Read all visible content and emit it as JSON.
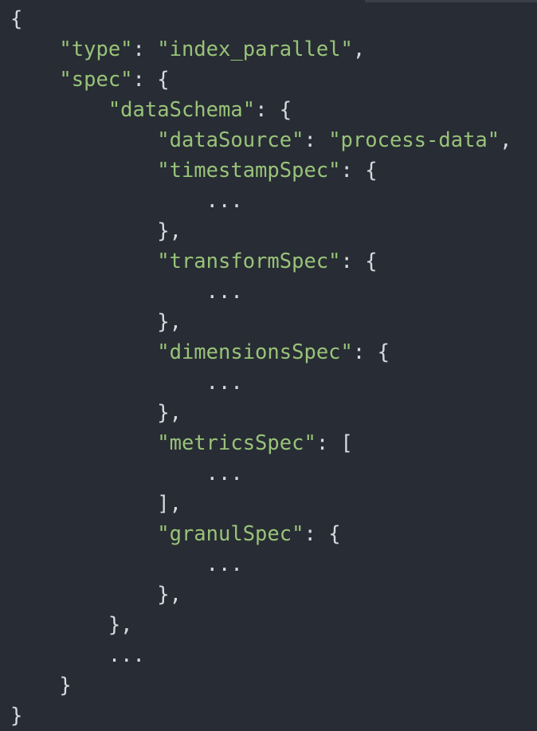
{
  "editor": {
    "lines": [
      {
        "indent": 0,
        "key": "",
        "sep": "",
        "value": "",
        "punct": "{"
      },
      {
        "indent": 1,
        "key": "\"type\"",
        "sep": ": ",
        "value": "\"index_parallel\"",
        "punct": ","
      },
      {
        "indent": 1,
        "key": "\"spec\"",
        "sep": ": ",
        "value": "",
        "punct": "{"
      },
      {
        "indent": 2,
        "key": "\"dataSchema\"",
        "sep": ": ",
        "value": "",
        "punct": "{"
      },
      {
        "indent": 3,
        "key": "\"dataSource\"",
        "sep": ": ",
        "value": "\"process-data\"",
        "punct": ","
      },
      {
        "indent": 3,
        "key": "\"timestampSpec\"",
        "sep": ": ",
        "value": "",
        "punct": "{"
      },
      {
        "indent": 4,
        "key": "",
        "sep": "",
        "value": "",
        "punct": "..."
      },
      {
        "indent": 3,
        "key": "",
        "sep": "",
        "value": "",
        "punct": "},"
      },
      {
        "indent": 3,
        "key": "\"transformSpec\"",
        "sep": ": ",
        "value": "",
        "punct": "{"
      },
      {
        "indent": 4,
        "key": "",
        "sep": "",
        "value": "",
        "punct": "..."
      },
      {
        "indent": 3,
        "key": "",
        "sep": "",
        "value": "",
        "punct": "},"
      },
      {
        "indent": 3,
        "key": "\"dimensionsSpec\"",
        "sep": ": ",
        "value": "",
        "punct": "{"
      },
      {
        "indent": 4,
        "key": "",
        "sep": "",
        "value": "",
        "punct": "..."
      },
      {
        "indent": 3,
        "key": "",
        "sep": "",
        "value": "",
        "punct": "},"
      },
      {
        "indent": 3,
        "key": "\"metricsSpec\"",
        "sep": ": ",
        "value": "",
        "punct": "["
      },
      {
        "indent": 4,
        "key": "",
        "sep": "",
        "value": "",
        "punct": "..."
      },
      {
        "indent": 3,
        "key": "",
        "sep": "",
        "value": "",
        "punct": "],"
      },
      {
        "indent": 3,
        "key": "\"granulSpec\"",
        "sep": ": ",
        "value": "",
        "punct": "{"
      },
      {
        "indent": 4,
        "key": "",
        "sep": "",
        "value": "",
        "punct": "..."
      },
      {
        "indent": 3,
        "key": "",
        "sep": "",
        "value": "",
        "punct": "},"
      },
      {
        "indent": 2,
        "key": "",
        "sep": "",
        "value": "",
        "punct": "},"
      },
      {
        "indent": 2,
        "key": "",
        "sep": "",
        "value": "",
        "punct": "..."
      },
      {
        "indent": 1,
        "key": "",
        "sep": "",
        "value": "",
        "punct": "}"
      },
      {
        "indent": 0,
        "key": "",
        "sep": "",
        "value": "",
        "punct": "}"
      }
    ]
  }
}
